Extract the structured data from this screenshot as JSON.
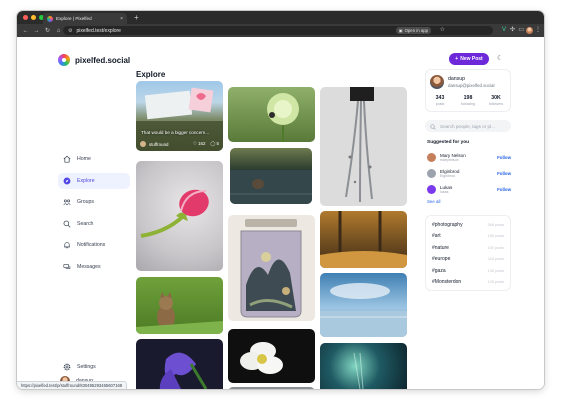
{
  "browser": {
    "tab_title": "Explore | Pixelfed",
    "tab_close": "×",
    "new_tab": "+",
    "url": "pixelfed.test/explore",
    "open_in_app": "Open in app",
    "status_url": "https://pixelfed.test/p/stuffround/830495293465607168"
  },
  "app": {
    "brand": "pixelfed.social",
    "new_post_label": "New Post",
    "page_title": "Explore"
  },
  "nav": {
    "items": [
      {
        "label": "Home",
        "icon": "home-icon"
      },
      {
        "label": "Explore",
        "icon": "compass-icon",
        "active": true
      },
      {
        "label": "Groups",
        "icon": "groups-icon"
      },
      {
        "label": "Search",
        "icon": "search-icon"
      },
      {
        "label": "Notifications",
        "icon": "bell-icon"
      },
      {
        "label": "Messages",
        "icon": "chat-icon"
      }
    ],
    "settings_label": "Settings",
    "user_label": "dansup"
  },
  "feed": {
    "featured": {
      "caption": "That would be a bigger concern...",
      "author": "stuffround",
      "likes": "162",
      "comments": "5"
    }
  },
  "profile": {
    "name": "dansup",
    "handle": "dansup@pixelfed.social",
    "stats": [
      {
        "value": "343",
        "label": "posts"
      },
      {
        "value": "198",
        "label": "following"
      },
      {
        "value": "30K",
        "label": "followers"
      }
    ]
  },
  "search": {
    "placeholder": "Search people, tags or pl..."
  },
  "suggestions": {
    "title": "Suggested for you",
    "follow_label": "Follow",
    "see_all": "See all",
    "people": [
      {
        "name": "Mary Nelson",
        "handle": "marynelson",
        "avatar_color": "#c67f5b"
      },
      {
        "name": "Elginbrod",
        "handle": "Elginbrod",
        "avatar_color": "#9ca3af"
      },
      {
        "name": "Lukas",
        "handle": "lukas",
        "avatar_color": "#7c3aed"
      }
    ]
  },
  "trending": [
    {
      "tag": "#photography",
      "count": "368 posts"
    },
    {
      "tag": "#art",
      "count": "156 posts"
    },
    {
      "tag": "#nature",
      "count": "100 posts"
    },
    {
      "tag": "#europe",
      "count": "118 posts"
    },
    {
      "tag": "#gaza",
      "count": "136 posts"
    },
    {
      "tag": "#Monsterdon",
      "count": "126 posts"
    }
  ],
  "colors": {
    "accent": "#6d28d9",
    "link": "#2563eb",
    "active_nav": "#4f46e5"
  }
}
